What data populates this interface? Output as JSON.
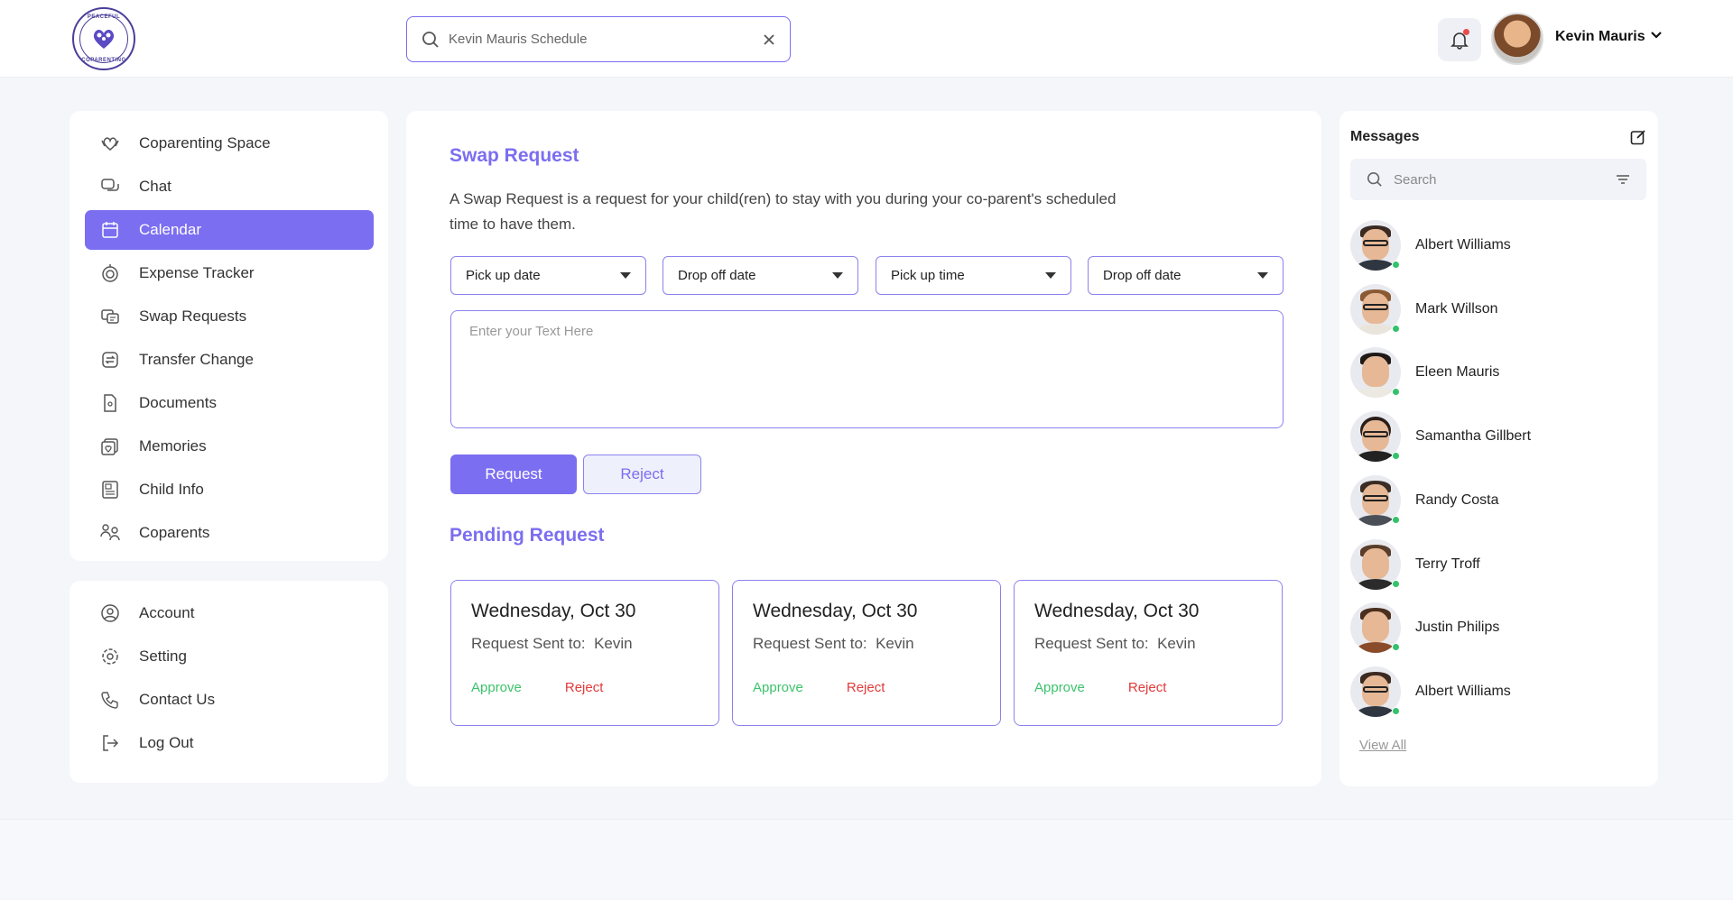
{
  "logo": {
    "top_text": "PEACEFUL",
    "bottom_text": "COPARENTING"
  },
  "header": {
    "search_value": "Kevin Mauris Schedule",
    "user_name": "Kevin Mauris"
  },
  "sidebar": {
    "items": [
      {
        "label": "Coparenting Space",
        "icon": "hands-heart-icon"
      },
      {
        "label": "Chat",
        "icon": "chat-bubbles-icon"
      },
      {
        "label": "Calendar",
        "icon": "calendar-icon",
        "active": true
      },
      {
        "label": "Expense Tracker",
        "icon": "coin-icon"
      },
      {
        "label": "Swap Requests",
        "icon": "swap-messages-icon"
      },
      {
        "label": "Transfer Change",
        "icon": "transfer-icon"
      },
      {
        "label": "Documents",
        "icon": "document-icon"
      },
      {
        "label": "Memories",
        "icon": "photo-heart-icon"
      },
      {
        "label": "Child Info",
        "icon": "child-info-icon"
      },
      {
        "label": "Coparents",
        "icon": "coparents-icon"
      }
    ],
    "bottom_items": [
      {
        "label": "Account",
        "icon": "user-circle-icon"
      },
      {
        "label": "Setting",
        "icon": "gear-icon"
      },
      {
        "label": "Contact Us",
        "icon": "phone-icon"
      },
      {
        "label": "Log Out",
        "icon": "logout-icon"
      }
    ]
  },
  "main": {
    "swap_title": "Swap Request",
    "description": "A Swap Request is a request for your child(ren) to stay with you during your co-parent's scheduled time to have them.",
    "dropdowns": [
      "Pick up date",
      "Drop off date",
      "Pick up time",
      "Drop off date"
    ],
    "textarea_placeholder": "Enter your Text Here",
    "request_button": "Request",
    "reject_button": "Reject",
    "pending_title": "Pending Request",
    "pending": [
      {
        "date": "Wednesday, Oct 30",
        "sent_label": "Request Sent to:",
        "sent_to": "Kevin",
        "approve": "Approve",
        "reject": "Reject"
      },
      {
        "date": "Wednesday, Oct 30",
        "sent_label": "Request Sent to:",
        "sent_to": "Kevin",
        "approve": "Approve",
        "reject": "Reject"
      },
      {
        "date": "Wednesday, Oct 30",
        "sent_label": "Request Sent to:",
        "sent_to": "Kevin",
        "approve": "Approve",
        "reject": "Reject"
      }
    ]
  },
  "messages": {
    "title": "Messages",
    "search_placeholder": "Search",
    "contacts": [
      {
        "name": "Albert Williams",
        "online": true
      },
      {
        "name": "Mark Willson",
        "online": true
      },
      {
        "name": "Eleen Mauris",
        "online": true
      },
      {
        "name": "Samantha Gillbert",
        "online": true
      },
      {
        "name": "Randy Costa",
        "online": true
      },
      {
        "name": "Terry Troff",
        "online": true
      },
      {
        "name": "Justin Philips",
        "online": true
      },
      {
        "name": "Albert Williams",
        "online": true
      }
    ],
    "view_all": "View All"
  },
  "colors": {
    "accent": "#7b6ef0",
    "approve": "#3cc36b",
    "reject": "#e23a3a",
    "online": "#33c26b"
  }
}
